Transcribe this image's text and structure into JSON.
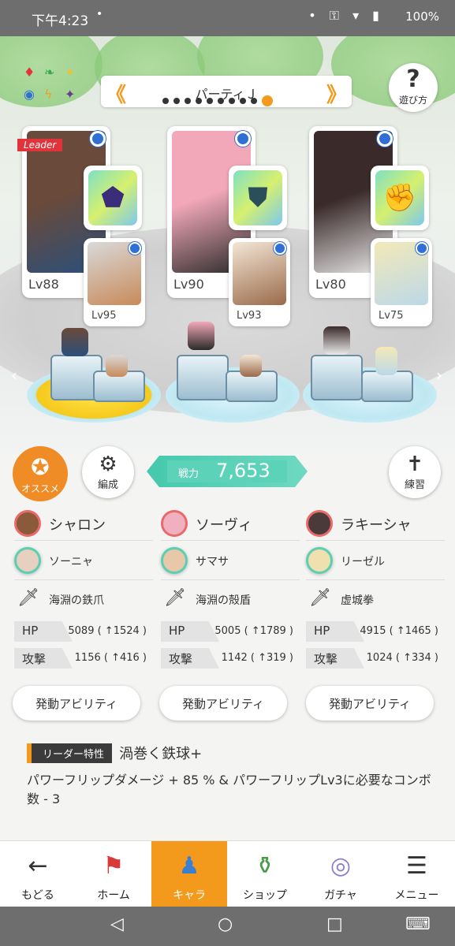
{
  "status_bar": {
    "time": "下午4:23",
    "dot": "•",
    "battery": "100%",
    "icons": "• ⚿ ▾ ▮"
  },
  "elements": [
    {
      "glyph": "♦",
      "color": "#e3333a"
    },
    {
      "glyph": "❧",
      "color": "#3aa84a"
    },
    {
      "glyph": "✦",
      "color": "#e8c43a"
    },
    {
      "glyph": "◉",
      "color": "#2f6fd6"
    },
    {
      "glyph": "ϟ",
      "color": "#f0a020"
    },
    {
      "glyph": "✦",
      "color": "#6a3a8a"
    }
  ],
  "party": {
    "name": "パーティＪ",
    "prev": "《",
    "next": "》",
    "page_count": 10,
    "current_page": 10
  },
  "help": {
    "icon": "?",
    "label": "遊び方"
  },
  "leader_tag": "Leader",
  "characters": [
    {
      "main_lv": "Lv88",
      "sub_lv": "Lv95",
      "main_colors": [
        "#6a4a3a",
        "#2b4f7a"
      ],
      "sub_colors": [
        "#d9d9d9",
        "#c88a5a"
      ],
      "equip_icon": "⬟",
      "equip_icon_color": "#3b2d7a",
      "main_name": "シャロン",
      "sub_name": "ソーニャ",
      "weapon": "海淵の鉄爪",
      "hp": "HP",
      "hp_value": "5089 ( ↑1524 )",
      "atk": "攻撃",
      "atk_value": "1156 ( ↑416 )",
      "ability_label": "発動アビリティ",
      "main_avatar": "#8a5a3a",
      "sub_avatar": "#e8d0c0"
    },
    {
      "main_lv": "Lv90",
      "sub_lv": "Lv93",
      "main_colors": [
        "#f2a8b8",
        "#2a2a2a"
      ],
      "sub_colors": [
        "#f3e6d6",
        "#9a6a4a"
      ],
      "equip_icon": "⛊",
      "equip_icon_color": "#2b4f5a",
      "main_name": "ソーヴィ",
      "sub_name": "サマサ",
      "weapon": "海淵の殻盾",
      "hp": "HP",
      "hp_value": "5005 ( ↑1789 )",
      "atk": "攻撃",
      "atk_value": "1142 ( ↑319 )",
      "ability_label": "発動アビリティ",
      "main_avatar": "#f0b0c0",
      "sub_avatar": "#e8c8a8"
    },
    {
      "main_lv": "Lv80",
      "sub_lv": "Lv75",
      "main_colors": [
        "#3a2a2a",
        "#eaeaea"
      ],
      "sub_colors": [
        "#f3e9b8",
        "#bcd8e8"
      ],
      "equip_icon": "✊",
      "equip_icon_color": "#2a2a3a",
      "main_name": "ラキーシャ",
      "sub_name": "リーゼル",
      "weapon": "虚城拳",
      "hp": "HP",
      "hp_value": "4915 ( ↑1465 )",
      "atk": "攻撃",
      "atk_value": "1024 ( ↑334 )",
      "ability_label": "発動アビリティ",
      "main_avatar": "#4a3a3a",
      "sub_avatar": "#f0e0b0"
    }
  ],
  "side_arrows": {
    "left": "‹",
    "right": "›"
  },
  "recommend": {
    "icon": "✪",
    "label": "オススメ"
  },
  "formation": {
    "icon": "⚙",
    "label": "編成"
  },
  "practice": {
    "icon": "✝",
    "label": "練習"
  },
  "power": {
    "label": "戦力",
    "value": "7,653"
  },
  "leader_skill": {
    "badge": "リーダー特性",
    "title": "渦巻く鉄球+",
    "description": "パワーフリップダメージ + 85 % & パワーフリップLv3に必要なコンボ数 - 3"
  },
  "bottom_nav": [
    {
      "icon": "←",
      "label": "もどる",
      "active": false
    },
    {
      "icon": "⚑",
      "label": "ホーム",
      "active": false
    },
    {
      "icon": "♟",
      "label": "キャラ",
      "active": true
    },
    {
      "icon": "⚱",
      "label": "ショップ",
      "active": false
    },
    {
      "icon": "◎",
      "label": "ガチャ",
      "active": false
    },
    {
      "icon": "☰",
      "label": "メニュー",
      "active": false
    }
  ],
  "system_nav": {
    "back": "◁",
    "home": "○",
    "recent": "□",
    "game": "⌨"
  },
  "colors": {
    "accent": "#f39a1c",
    "power": "#45c8ad",
    "leader_red": "#e3333a",
    "select_blue": "#2f6fd6"
  }
}
